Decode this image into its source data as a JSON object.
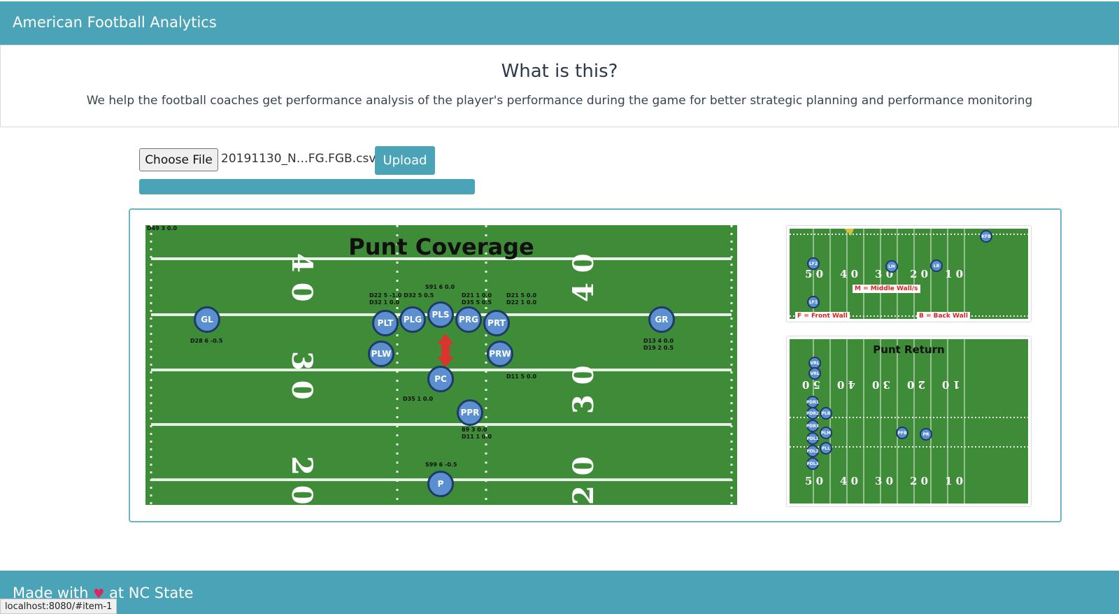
{
  "header": {
    "brand": "American Football Analytics"
  },
  "about": {
    "title": "What is this?",
    "description": "We help the football coaches get performance analysis of the player's performance during the game for better strategic planning and performance monitoring"
  },
  "upload": {
    "choose_label": "Choose File",
    "file_name": "20191130_N…FG.FGB.csv",
    "upload_label": "Upload",
    "progress_percent": 100
  },
  "main_view": {
    "title": "Punt Coverage",
    "corner_text": "D49 3 0.0",
    "players": [
      "GL",
      "PLT",
      "PLG",
      "PLS",
      "PRG",
      "PRT",
      "GR",
      "PLW",
      "PRW",
      "PC",
      "PPR",
      "P"
    ],
    "annotations": [
      "S91 6 0.0",
      "D22 5 -1.0 D32 5 0.5\nD32 1 0.0",
      "D21 1 0.0\nD35 5 0.5",
      "D21 5 0.0\nD22 1 0.0",
      "D28 6 -0.5",
      "D13 4 0.0\nD19 2 0.5",
      "D11 5 0.0",
      "D35 1 0.0",
      "89 3 0.0\nD11 1 0.0",
      "S99 6 -0.5"
    ]
  },
  "thumbnails": {
    "first": {
      "middle_wall_label": "M = Middle Wall/s",
      "front_wall_label": "F = Front Wall",
      "back_wall_label": "B = Back Wall",
      "players": [
        "LF2",
        "LM",
        "LB",
        "LF1",
        "KFB"
      ]
    },
    "second": {
      "title": "Punt Return",
      "players": [
        "VRL",
        "VRL",
        "PDR1",
        "PDR2",
        "PLR",
        "PDR3",
        "PLM",
        "PFB",
        "PR",
        "PDL1",
        "PDL2",
        "PLL",
        "PDL3"
      ]
    }
  },
  "footer": {
    "prefix": "Made with",
    "suffix": "at NC State",
    "heart": "♥"
  },
  "status_bar": {
    "url": "localhost:8080/#item-1"
  },
  "colors": {
    "primary": "#4aa3b6",
    "field": "#3c8a35",
    "player": "#5b8fd0"
  }
}
